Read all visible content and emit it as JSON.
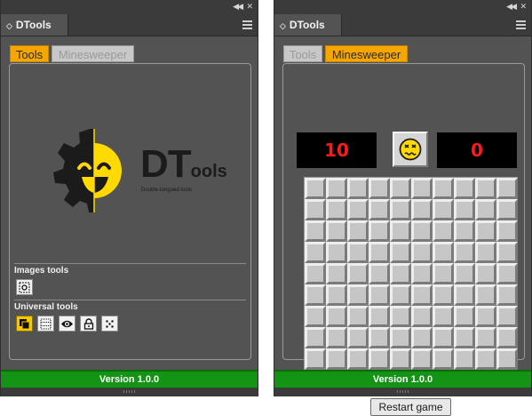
{
  "panels": [
    {
      "tab_title": "DTools",
      "content_tabs": [
        "Tools",
        "Minesweeper"
      ],
      "logo": {
        "wordmark_big": "DT",
        "wordmark_small": "ools",
        "tagline": "Double-tongued tools"
      },
      "sections": {
        "images_tools": "Images tools",
        "universal_tools": "Universal tools"
      },
      "footer": "Version 1.0.0"
    },
    {
      "tab_title": "DTools",
      "content_tabs": [
        "Tools",
        "Minesweeper"
      ],
      "minesweeper": {
        "mines_left": "10",
        "timer": "0",
        "face": "dizzy",
        "rows": 10,
        "cols": 10
      },
      "restart_label": "Restart game",
      "footer": "Version 1.0.0"
    }
  ],
  "icons": {
    "images_tools": [
      "frame-target-icon"
    ],
    "universal_tools": [
      "layers-icon",
      "dotted-grid-icon",
      "eye-icon",
      "lock-icon",
      "dice-icon"
    ]
  },
  "colors": {
    "panel": "#535353",
    "accent": "#f5a700",
    "footer": "#149414",
    "lcd_digits": "#ff1a1a"
  }
}
